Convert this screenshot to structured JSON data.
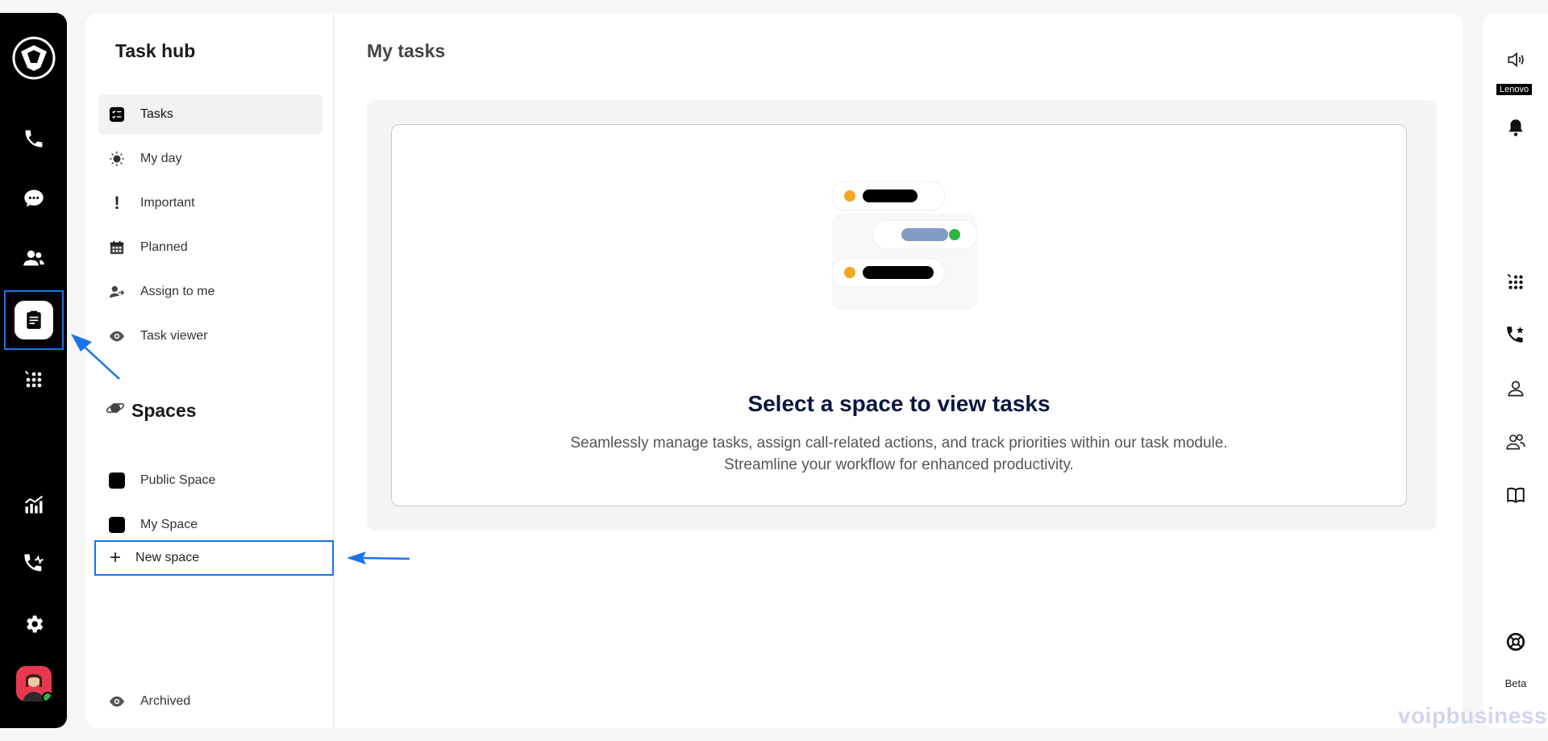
{
  "left_rail": {
    "items": [
      {
        "name": "logo-icon"
      },
      {
        "name": "phone-icon"
      },
      {
        "name": "chat-icon"
      },
      {
        "name": "contacts-icon"
      },
      {
        "name": "tasks-icon",
        "active": true
      },
      {
        "name": "dialpad-icon"
      },
      {
        "name": "analytics-icon"
      },
      {
        "name": "call-activity-icon"
      },
      {
        "name": "settings-icon"
      },
      {
        "name": "avatar"
      }
    ]
  },
  "sidebar": {
    "title": "Task hub",
    "items": [
      {
        "label": "Tasks",
        "icon": "tasks-list-icon",
        "active": true
      },
      {
        "label": "My day",
        "icon": "sun-icon"
      },
      {
        "label": "Important",
        "icon": "exclamation-icon"
      },
      {
        "label": "Planned",
        "icon": "calendar-icon"
      },
      {
        "label": "Assign to me",
        "icon": "assign-user-icon"
      },
      {
        "label": "Task viewer",
        "icon": "eye-icon"
      }
    ],
    "spaces_title": "Spaces",
    "spaces": [
      {
        "label": "Public Space"
      },
      {
        "label": "My Space"
      }
    ],
    "new_space_label": "New space",
    "archived_label": "Archived"
  },
  "main": {
    "title": "My tasks",
    "empty_title": "Select a space to view tasks",
    "empty_desc_line1": "Seamlessly manage tasks, assign call-related actions, and track priorities within our task module.",
    "empty_desc_line2": "Streamline your workflow for enhanced productivity."
  },
  "right_rail": {
    "device_label": "Lenovo",
    "beta_label": "Beta"
  },
  "watermark": "voipbusiness",
  "colors": {
    "accent": "#1a73e8",
    "rail_bg": "#000000",
    "dot_orange": "#f5a623",
    "dot_green": "#2fb344",
    "pill_blue": "#7f9cc4",
    "heading": "#0b1540"
  }
}
